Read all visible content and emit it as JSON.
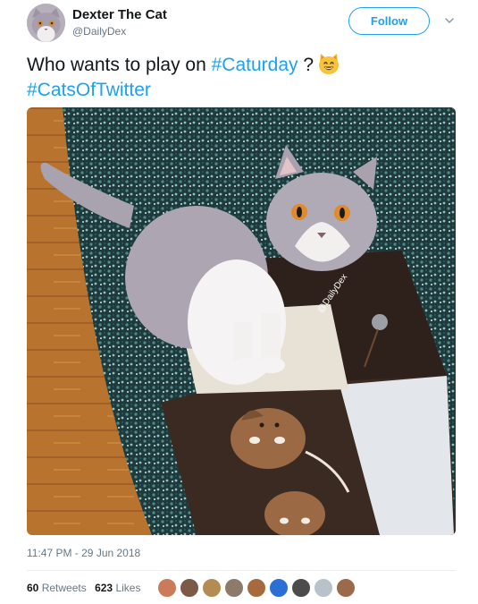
{
  "user": {
    "name": "Dexter The Cat",
    "handle": "@DailyDex",
    "follow_label": "Follow"
  },
  "tweet": {
    "text_prefix": "Who wants to play on ",
    "hashtag_1": "#Caturday",
    "text_middle": " ?",
    "hashtag_2": "#CatsOfTwitter",
    "emoji": "smiling-cat-face-emoji"
  },
  "photo": {
    "watermark": "@DailyDex"
  },
  "meta": {
    "timestamp": "11:47 PM - 29 Jun 2018"
  },
  "stats": {
    "retweets_count": "60",
    "retweets_label": "Retweets",
    "likes_count": "623",
    "likes_label": "Likes"
  },
  "likers": [
    {
      "color": "#c97b5a"
    },
    {
      "color": "#7b5a48"
    },
    {
      "color": "#b48c53"
    },
    {
      "color": "#8e7a6a"
    },
    {
      "color": "#a66a3e"
    },
    {
      "color": "#2a6fd6"
    },
    {
      "color": "#4c4c4c"
    },
    {
      "color": "#b9c2ca"
    },
    {
      "color": "#9b6a4b"
    }
  ],
  "colors": {
    "accent": "#1da1f2",
    "text": "#14171a",
    "muted": "#657786"
  }
}
